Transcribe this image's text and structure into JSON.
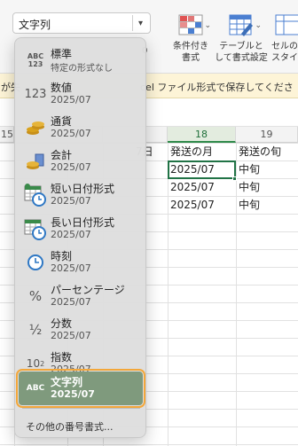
{
  "ribbon": {
    "number_format_value": "文字列",
    "conditional_format_label": [
      "条件付き",
      "書式"
    ],
    "table_format_label": [
      "テーブルと",
      "して書式設定"
    ],
    "cell_style_label": [
      "セルの",
      "スタイ"
    ],
    "bg_text_right": "0"
  },
  "infobar": {
    "prefix": "が失",
    "message": "cel ファイル形式で保存してくださ"
  },
  "sheet": {
    "col_headers": [
      "15",
      "",
      "",
      "",
      "",
      "18",
      "19"
    ],
    "row1": {
      "partial": "7日",
      "c18": "発送の月",
      "c19": "発送の旬"
    },
    "rows": [
      {
        "c18": "2025/07",
        "c19": "中旬"
      },
      {
        "c18": "2025/07",
        "c19": "中旬"
      },
      {
        "c18": "2025/07",
        "c19": "中旬"
      }
    ]
  },
  "dropdown": {
    "items": [
      {
        "name": "標準",
        "example": "特定の形式なし",
        "icon": "abc-123-icon"
      },
      {
        "name": "数値",
        "example": "2025/07",
        "icon": "number-123-icon"
      },
      {
        "name": "通貨",
        "example": "2025/07",
        "icon": "coins-icon"
      },
      {
        "name": "会計",
        "example": "2025/07",
        "icon": "accounting-coins-icon"
      },
      {
        "name": "短い日付形式",
        "example": "2025/07",
        "icon": "calendar-clock-icon"
      },
      {
        "name": "長い日付形式",
        "example": "2025/07",
        "icon": "calendar-clock-icon"
      },
      {
        "name": "時刻",
        "example": "2025/07",
        "icon": "clock-icon"
      },
      {
        "name": "パーセンテージ",
        "example": "2025/07",
        "icon": "percent-icon"
      },
      {
        "name": "分数",
        "example": "2025/07",
        "icon": "fraction-icon"
      },
      {
        "name": "指数",
        "example": "2025/07",
        "icon": "exponent-icon"
      },
      {
        "name": "文字列",
        "example": "2025/07",
        "icon": "abc-icon",
        "selected": true
      }
    ],
    "more_label": "その他の番号書式...",
    "colors": {
      "selected_bg": "#7f9a7d",
      "selected_outline": "#f3a73a",
      "clock_blue": "#2f78c4",
      "coin_gold": "#d9a21c"
    }
  }
}
